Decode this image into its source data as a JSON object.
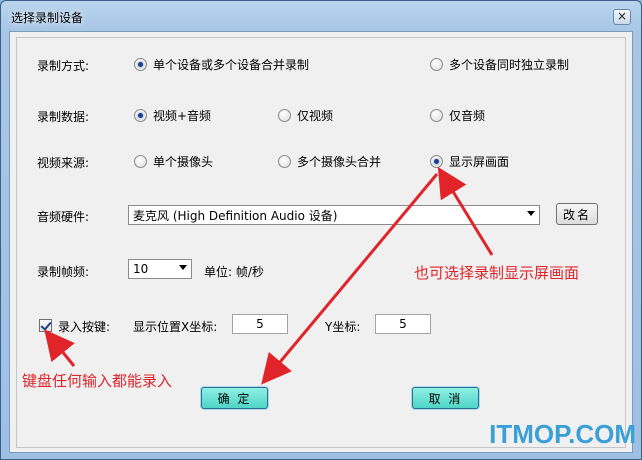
{
  "window": {
    "title": "选择录制设备",
    "close_glyph": "×"
  },
  "mode": {
    "label": "录制方式:",
    "options": [
      "单个设备或多个设备合并录制",
      "多个设备同时独立录制"
    ],
    "selected": 0
  },
  "data": {
    "label": "录制数据:",
    "options": [
      "视频+音频",
      "仅视频",
      "仅音频"
    ],
    "selected": 0
  },
  "source": {
    "label": "视频来源:",
    "options": [
      "单个摄像头",
      "多个摄像头合并",
      "显示屏画面"
    ],
    "selected": 2
  },
  "audio": {
    "label": "音频硬件:",
    "device": "麦克风 (High Definition Audio 设备)",
    "rename_label": "改名"
  },
  "fps": {
    "label": "录制帧频:",
    "value": "10",
    "unit": "单位: 帧/秒"
  },
  "keys": {
    "checkbox_label": "录入按键:",
    "checked": true,
    "x_label": "显示位置X坐标:",
    "x_value": "5",
    "y_label": "Y坐标:",
    "y_value": "5"
  },
  "buttons": {
    "ok": "确 定",
    "cancel": "取 消"
  },
  "annotations": {
    "right": "也可选择录制显示屏画面",
    "left": "键盘任何输入都能录入",
    "color": "#e0242a"
  },
  "watermark": "ITMOP.COM"
}
